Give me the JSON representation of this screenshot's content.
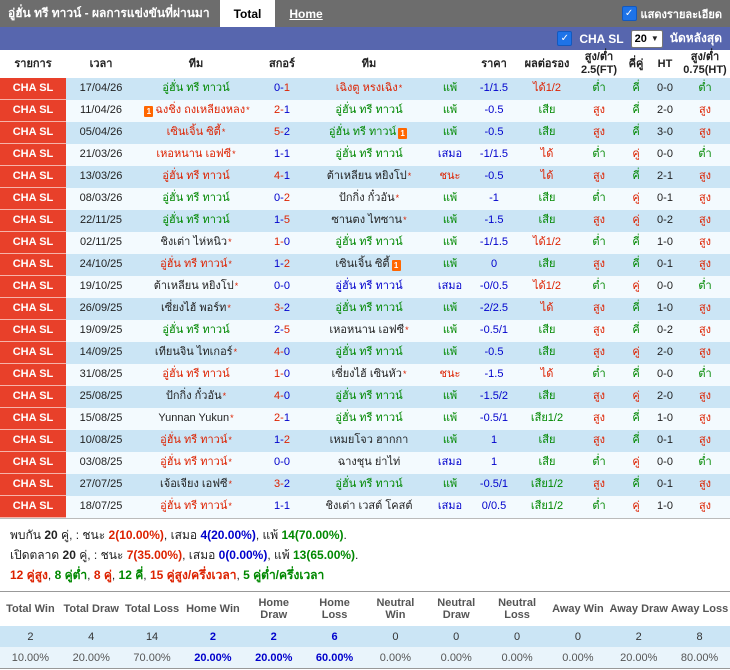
{
  "topbar": {
    "title": "อู่ฮั่น ทรี ทาวน์ - ผลการแข่งขันที่ผ่านมา",
    "tab_total": "Total",
    "tab_home": "Home",
    "show_details_label": "แสดงรายละเอียด"
  },
  "filterbar": {
    "league_label": "CHA SL",
    "match_count": "20",
    "recent_label": "นัดหลังสุด"
  },
  "table": {
    "headers": [
      "รายการ",
      "เวลา",
      "ทีม",
      "สกอร์",
      "ทีม",
      "",
      "ราคา",
      "ผลต่อรอง",
      "สูง/ต่ำ 2.5(FT)",
      "คี่คู่",
      "HT",
      "สูง/ต่ำ 0.75(HT)"
    ],
    "rows": [
      {
        "league": "CHA SL",
        "date": "17/04/26",
        "h": {
          "n": "อู่ฮั่น ทรี ทาวน์",
          "c": "green"
        },
        "s": {
          "h": "0",
          "a": "1",
          "hc": "blue",
          "ac": "red"
        },
        "a": {
          "n": "เฉิงตู หรงเฉิง",
          "c": "red",
          "star": true
        },
        "res": {
          "t": "แพ้",
          "c": "green"
        },
        "price": "-1/1.5",
        "hdp": {
          "t": "ได้1/2",
          "c": "red"
        },
        "ou": {
          "t": "ต่ำ",
          "c": "green"
        },
        "oe": {
          "t": "คี่",
          "c": "green"
        },
        "ht": "0-0",
        "ouht": {
          "t": "ต่ำ",
          "c": "green"
        }
      },
      {
        "league": "CHA SL",
        "date": "11/04/26",
        "h": {
          "n": "ฉงชิ่ง ถงเหลียงหลง",
          "c": "red",
          "star": true,
          "icon": "before"
        },
        "s": {
          "h": "2",
          "a": "1",
          "hc": "red",
          "ac": "blue"
        },
        "a": {
          "n": "อู่ฮั่น ทรี ทาวน์",
          "c": "green"
        },
        "res": {
          "t": "แพ้",
          "c": "green"
        },
        "price": "-0.5",
        "hdp": {
          "t": "เสีย",
          "c": "green"
        },
        "ou": {
          "t": "สูง",
          "c": "red"
        },
        "oe": {
          "t": "คี่",
          "c": "green"
        },
        "ht": "2-0",
        "ouht": {
          "t": "สูง",
          "c": "red"
        }
      },
      {
        "league": "CHA SL",
        "date": "05/04/26",
        "h": {
          "n": "เซินเจิ้น ซิตี้",
          "c": "red",
          "star": true
        },
        "s": {
          "h": "5",
          "a": "2",
          "hc": "red",
          "ac": "blue"
        },
        "a": {
          "n": "อู่ฮั่น ทรี ทาวน์",
          "c": "green",
          "icon": "after"
        },
        "res": {
          "t": "แพ้",
          "c": "green"
        },
        "price": "-0.5",
        "hdp": {
          "t": "เสีย",
          "c": "green"
        },
        "ou": {
          "t": "สูง",
          "c": "red"
        },
        "oe": {
          "t": "คี่",
          "c": "green"
        },
        "ht": "3-0",
        "ouht": {
          "t": "สูง",
          "c": "red"
        }
      },
      {
        "league": "CHA SL",
        "date": "21/03/26",
        "h": {
          "n": "เหอหนาน เอฟซี",
          "c": "red",
          "star": true
        },
        "s": {
          "h": "1",
          "a": "1",
          "hc": "blue",
          "ac": "blue"
        },
        "a": {
          "n": "อู่ฮั่น ทรี ทาวน์",
          "c": "green"
        },
        "res": {
          "t": "เสมอ",
          "c": "blue"
        },
        "price": "-1/1.5",
        "hdp": {
          "t": "ได้",
          "c": "red"
        },
        "ou": {
          "t": "ต่ำ",
          "c": "green"
        },
        "oe": {
          "t": "คู่",
          "c": "red"
        },
        "ht": "0-0",
        "ouht": {
          "t": "ต่ำ",
          "c": "green"
        }
      },
      {
        "league": "CHA SL",
        "date": "13/03/26",
        "h": {
          "n": "อู่ฮั่น ทรี ทาวน์",
          "c": "red"
        },
        "s": {
          "h": "4",
          "a": "1",
          "hc": "red",
          "ac": "blue"
        },
        "a": {
          "n": "ต้าเหลียน หยิงโป",
          "c": "black",
          "star": true
        },
        "res": {
          "t": "ชนะ",
          "c": "red"
        },
        "price": "-0.5",
        "hdp": {
          "t": "ได้",
          "c": "red"
        },
        "ou": {
          "t": "สูง",
          "c": "red"
        },
        "oe": {
          "t": "คี่",
          "c": "green"
        },
        "ht": "2-1",
        "ouht": {
          "t": "สูง",
          "c": "red"
        }
      },
      {
        "league": "CHA SL",
        "date": "08/03/26",
        "h": {
          "n": "อู่ฮั่น ทรี ทาวน์",
          "c": "green"
        },
        "s": {
          "h": "0",
          "a": "2",
          "hc": "blue",
          "ac": "red"
        },
        "a": {
          "n": "ปักกิ่ง กั๋วอัน",
          "c": "black",
          "star": true
        },
        "res": {
          "t": "แพ้",
          "c": "green"
        },
        "price": "-1",
        "hdp": {
          "t": "เสีย",
          "c": "green"
        },
        "ou": {
          "t": "ต่ำ",
          "c": "green"
        },
        "oe": {
          "t": "คู่",
          "c": "red"
        },
        "ht": "0-1",
        "ouht": {
          "t": "สูง",
          "c": "red"
        }
      },
      {
        "league": "CHA SL",
        "date": "22/11/25",
        "h": {
          "n": "อู่ฮั่น ทรี ทาวน์",
          "c": "green"
        },
        "s": {
          "h": "1",
          "a": "5",
          "hc": "blue",
          "ac": "red"
        },
        "a": {
          "n": "ซานตง ไทซาน",
          "c": "black",
          "star": true
        },
        "res": {
          "t": "แพ้",
          "c": "green"
        },
        "price": "-1.5",
        "hdp": {
          "t": "เสีย",
          "c": "green"
        },
        "ou": {
          "t": "สูง",
          "c": "red"
        },
        "oe": {
          "t": "คู่",
          "c": "red"
        },
        "ht": "0-2",
        "ouht": {
          "t": "สูง",
          "c": "red"
        }
      },
      {
        "league": "CHA SL",
        "date": "02/11/25",
        "h": {
          "n": "ชิงเต่า ไห่หนิว",
          "c": "black",
          "star": true
        },
        "s": {
          "h": "1",
          "a": "0",
          "hc": "red",
          "ac": "blue"
        },
        "a": {
          "n": "อู่ฮั่น ทรี ทาวน์",
          "c": "green"
        },
        "res": {
          "t": "แพ้",
          "c": "green"
        },
        "price": "-1/1.5",
        "hdp": {
          "t": "ได้1/2",
          "c": "red"
        },
        "ou": {
          "t": "ต่ำ",
          "c": "green"
        },
        "oe": {
          "t": "คี่",
          "c": "green"
        },
        "ht": "1-0",
        "ouht": {
          "t": "สูง",
          "c": "red"
        }
      },
      {
        "league": "CHA SL",
        "date": "24/10/25",
        "h": {
          "n": "อู่ฮั่น ทรี ทาวน์",
          "c": "red",
          "star": true
        },
        "s": {
          "h": "1",
          "a": "2",
          "hc": "blue",
          "ac": "red"
        },
        "a": {
          "n": "เซินเจิ้น ซิตี้",
          "c": "black",
          "icon": "after"
        },
        "res": {
          "t": "แพ้",
          "c": "green"
        },
        "price": "0",
        "hdp": {
          "t": "เสีย",
          "c": "green"
        },
        "ou": {
          "t": "สูง",
          "c": "red"
        },
        "oe": {
          "t": "คี่",
          "c": "green"
        },
        "ht": "0-1",
        "ouht": {
          "t": "สูง",
          "c": "red"
        }
      },
      {
        "league": "CHA SL",
        "date": "19/10/25",
        "h": {
          "n": "ต้าเหลียน หยิงโป",
          "c": "black",
          "star": true
        },
        "s": {
          "h": "0",
          "a": "0",
          "hc": "blue",
          "ac": "blue"
        },
        "a": {
          "n": "อู่ฮั่น ทรี ทาวน์",
          "c": "blue"
        },
        "res": {
          "t": "เสมอ",
          "c": "blue"
        },
        "price": "-0/0.5",
        "hdp": {
          "t": "ได้1/2",
          "c": "red"
        },
        "ou": {
          "t": "ต่ำ",
          "c": "green"
        },
        "oe": {
          "t": "คู่",
          "c": "red"
        },
        "ht": "0-0",
        "ouht": {
          "t": "ต่ำ",
          "c": "green"
        }
      },
      {
        "league": "CHA SL",
        "date": "26/09/25",
        "h": {
          "n": "เซี่ยงไฮ้ พอร์ท",
          "c": "black",
          "star": true
        },
        "s": {
          "h": "3",
          "a": "2",
          "hc": "red",
          "ac": "blue"
        },
        "a": {
          "n": "อู่ฮั่น ทรี ทาวน์",
          "c": "green"
        },
        "res": {
          "t": "แพ้",
          "c": "green"
        },
        "price": "-2/2.5",
        "hdp": {
          "t": "ได้",
          "c": "red"
        },
        "ou": {
          "t": "สูง",
          "c": "red"
        },
        "oe": {
          "t": "คี่",
          "c": "green"
        },
        "ht": "1-0",
        "ouht": {
          "t": "สูง",
          "c": "red"
        }
      },
      {
        "league": "CHA SL",
        "date": "19/09/25",
        "h": {
          "n": "อู่ฮั่น ทรี ทาวน์",
          "c": "green"
        },
        "s": {
          "h": "2",
          "a": "5",
          "hc": "blue",
          "ac": "red"
        },
        "a": {
          "n": "เหอหนาน เอฟซี",
          "c": "black",
          "star": true
        },
        "res": {
          "t": "แพ้",
          "c": "green"
        },
        "price": "-0.5/1",
        "hdp": {
          "t": "เสีย",
          "c": "green"
        },
        "ou": {
          "t": "สูง",
          "c": "red"
        },
        "oe": {
          "t": "คี่",
          "c": "green"
        },
        "ht": "0-2",
        "ouht": {
          "t": "สูง",
          "c": "red"
        }
      },
      {
        "league": "CHA SL",
        "date": "14/09/25",
        "h": {
          "n": "เทียนจิน ไทเกอร์",
          "c": "black",
          "star": true
        },
        "s": {
          "h": "4",
          "a": "0",
          "hc": "red",
          "ac": "blue"
        },
        "a": {
          "n": "อู่ฮั่น ทรี ทาวน์",
          "c": "green"
        },
        "res": {
          "t": "แพ้",
          "c": "green"
        },
        "price": "-0.5",
        "hdp": {
          "t": "เสีย",
          "c": "green"
        },
        "ou": {
          "t": "สูง",
          "c": "red"
        },
        "oe": {
          "t": "คู่",
          "c": "red"
        },
        "ht": "2-0",
        "ouht": {
          "t": "สูง",
          "c": "red"
        }
      },
      {
        "league": "CHA SL",
        "date": "31/08/25",
        "h": {
          "n": "อู่ฮั่น ทรี ทาวน์",
          "c": "red"
        },
        "s": {
          "h": "1",
          "a": "0",
          "hc": "red",
          "ac": "blue"
        },
        "a": {
          "n": "เซี่ยงไฮ้ เซินหัว",
          "c": "black",
          "star": true
        },
        "res": {
          "t": "ชนะ",
          "c": "red"
        },
        "price": "-1.5",
        "hdp": {
          "t": "ได้",
          "c": "red"
        },
        "ou": {
          "t": "ต่ำ",
          "c": "green"
        },
        "oe": {
          "t": "คี่",
          "c": "green"
        },
        "ht": "0-0",
        "ouht": {
          "t": "ต่ำ",
          "c": "green"
        }
      },
      {
        "league": "CHA SL",
        "date": "25/08/25",
        "h": {
          "n": "ปักกิ่ง กั๋วอัน",
          "c": "black",
          "star": true
        },
        "s": {
          "h": "4",
          "a": "0",
          "hc": "red",
          "ac": "blue"
        },
        "a": {
          "n": "อู่ฮั่น ทรี ทาวน์",
          "c": "green"
        },
        "res": {
          "t": "แพ้",
          "c": "green"
        },
        "price": "-1.5/2",
        "hdp": {
          "t": "เสีย",
          "c": "green"
        },
        "ou": {
          "t": "สูง",
          "c": "red"
        },
        "oe": {
          "t": "คู่",
          "c": "red"
        },
        "ht": "2-0",
        "ouht": {
          "t": "สูง",
          "c": "red"
        }
      },
      {
        "league": "CHA SL",
        "date": "15/08/25",
        "h": {
          "n": "Yunnan Yukun",
          "c": "black",
          "star": true
        },
        "s": {
          "h": "2",
          "a": "1",
          "hc": "red",
          "ac": "blue"
        },
        "a": {
          "n": "อู่ฮั่น ทรี ทาวน์",
          "c": "green"
        },
        "res": {
          "t": "แพ้",
          "c": "green"
        },
        "price": "-0.5/1",
        "hdp": {
          "t": "เสีย1/2",
          "c": "green"
        },
        "ou": {
          "t": "สูง",
          "c": "red"
        },
        "oe": {
          "t": "คี่",
          "c": "green"
        },
        "ht": "1-0",
        "ouht": {
          "t": "สูง",
          "c": "red"
        }
      },
      {
        "league": "CHA SL",
        "date": "10/08/25",
        "h": {
          "n": "อู่ฮั่น ทรี ทาวน์",
          "c": "red",
          "star": true
        },
        "s": {
          "h": "1",
          "a": "2",
          "hc": "blue",
          "ac": "red"
        },
        "a": {
          "n": "เหมยโจว ฮากกา",
          "c": "black"
        },
        "res": {
          "t": "แพ้",
          "c": "green"
        },
        "price": "1",
        "hdp": {
          "t": "เสีย",
          "c": "green"
        },
        "ou": {
          "t": "สูง",
          "c": "red"
        },
        "oe": {
          "t": "คี่",
          "c": "green"
        },
        "ht": "0-1",
        "ouht": {
          "t": "สูง",
          "c": "red"
        }
      },
      {
        "league": "CHA SL",
        "date": "03/08/25",
        "h": {
          "n": "อู่ฮั่น ทรี ทาวน์",
          "c": "red",
          "star": true
        },
        "s": {
          "h": "0",
          "a": "0",
          "hc": "blue",
          "ac": "blue"
        },
        "a": {
          "n": "ฉางชุน ย่าไท่",
          "c": "black"
        },
        "res": {
          "t": "เสมอ",
          "c": "blue"
        },
        "price": "1",
        "hdp": {
          "t": "เสีย",
          "c": "green"
        },
        "ou": {
          "t": "ต่ำ",
          "c": "green"
        },
        "oe": {
          "t": "คู่",
          "c": "red"
        },
        "ht": "0-0",
        "ouht": {
          "t": "ต่ำ",
          "c": "green"
        }
      },
      {
        "league": "CHA SL",
        "date": "27/07/25",
        "h": {
          "n": "เจ้อเจียง เอฟซี",
          "c": "black",
          "star": true
        },
        "s": {
          "h": "3",
          "a": "2",
          "hc": "red",
          "ac": "blue"
        },
        "a": {
          "n": "อู่ฮั่น ทรี ทาวน์",
          "c": "green"
        },
        "res": {
          "t": "แพ้",
          "c": "green"
        },
        "price": "-0.5/1",
        "hdp": {
          "t": "เสีย1/2",
          "c": "green"
        },
        "ou": {
          "t": "สูง",
          "c": "red"
        },
        "oe": {
          "t": "คี่",
          "c": "green"
        },
        "ht": "0-1",
        "ouht": {
          "t": "สูง",
          "c": "red"
        }
      },
      {
        "league": "CHA SL",
        "date": "18/07/25",
        "h": {
          "n": "อู่ฮั่น ทรี ทาวน์",
          "c": "red",
          "star": true
        },
        "s": {
          "h": "1",
          "a": "1",
          "hc": "blue",
          "ac": "blue"
        },
        "a": {
          "n": "ชิงเต่า เวสต์ โคสต์",
          "c": "black"
        },
        "res": {
          "t": "เสมอ",
          "c": "blue"
        },
        "price": "0/0.5",
        "hdp": {
          "t": "เสีย1/2",
          "c": "green"
        },
        "ou": {
          "t": "ต่ำ",
          "c": "green"
        },
        "oe": {
          "t": "คู่",
          "c": "red"
        },
        "ht": "1-0",
        "ouht": {
          "t": "สูง",
          "c": "red"
        }
      }
    ]
  },
  "summary": {
    "lines": [
      [
        {
          "t": "พบกัน ",
          "c": "black"
        },
        {
          "t": "20",
          "c": "black",
          "b": true
        },
        {
          "t": " คู่, : ชนะ ",
          "c": "black"
        },
        {
          "t": "2(10.00%)",
          "c": "red",
          "b": true
        },
        {
          "t": ", เสมอ ",
          "c": "black"
        },
        {
          "t": "4(20.00%)",
          "c": "blue",
          "b": true
        },
        {
          "t": ", แพ้ ",
          "c": "black"
        },
        {
          "t": "14(70.00%)",
          "c": "green",
          "b": true
        },
        {
          "t": ".",
          "c": "black"
        }
      ],
      [
        {
          "t": "เปิดตลาด ",
          "c": "black"
        },
        {
          "t": "20",
          "c": "black",
          "b": true
        },
        {
          "t": " คู่, : ชนะ ",
          "c": "black"
        },
        {
          "t": "7(35.00%)",
          "c": "red",
          "b": true
        },
        {
          "t": ", เสมอ ",
          "c": "black"
        },
        {
          "t": "0(0.00%)",
          "c": "blue",
          "b": true
        },
        {
          "t": ", แพ้ ",
          "c": "black"
        },
        {
          "t": "13(65.00%)",
          "c": "green",
          "b": true
        },
        {
          "t": ".",
          "c": "black"
        }
      ],
      [
        {
          "t": "12 คู่สูง",
          "c": "red",
          "b": true
        },
        {
          "t": ", ",
          "c": "black"
        },
        {
          "t": "8 คู่ต่ำ",
          "c": "green",
          "b": true
        },
        {
          "t": ", ",
          "c": "black"
        },
        {
          "t": "8 คู่",
          "c": "red",
          "b": true
        },
        {
          "t": ", ",
          "c": "black"
        },
        {
          "t": "12 คี่",
          "c": "green",
          "b": true
        },
        {
          "t": ", ",
          "c": "black"
        },
        {
          "t": "15 คู่สูง/ครึ่งเวลา",
          "c": "red",
          "b": true
        },
        {
          "t": ", ",
          "c": "black"
        },
        {
          "t": "5 คู่ต่ำ/ครึ่งเวลา",
          "c": "green",
          "b": true
        }
      ]
    ]
  },
  "footer": {
    "headers": [
      "Total Win",
      "Total Draw",
      "Total Loss",
      "Home Win",
      "Home Draw",
      "Home Loss",
      "Neutral Win",
      "Neutral Draw",
      "Neutral Loss",
      "Away Win",
      "Away Draw",
      "Away Loss"
    ],
    "values": [
      "2",
      "4",
      "14",
      "2",
      "2",
      "6",
      "0",
      "0",
      "0",
      "0",
      "2",
      "8"
    ],
    "percents": [
      "10.00%",
      "20.00%",
      "70.00%",
      "20.00%",
      "20.00%",
      "60.00%",
      "0.00%",
      "0.00%",
      "0.00%",
      "0.00%",
      "20.00%",
      "80.00%"
    ],
    "highlight_indices": [
      3,
      4,
      5
    ]
  },
  "colors": {
    "league_badge_red": "#e8402a",
    "filter_bar_blue": "#5766ae",
    "topbar_gray": "#6d6d6d",
    "win_red": "#dd2200",
    "loss_green": "#008800",
    "draw_blue": "#0000cc",
    "row_stripe_blue": "#cbe5f5"
  }
}
